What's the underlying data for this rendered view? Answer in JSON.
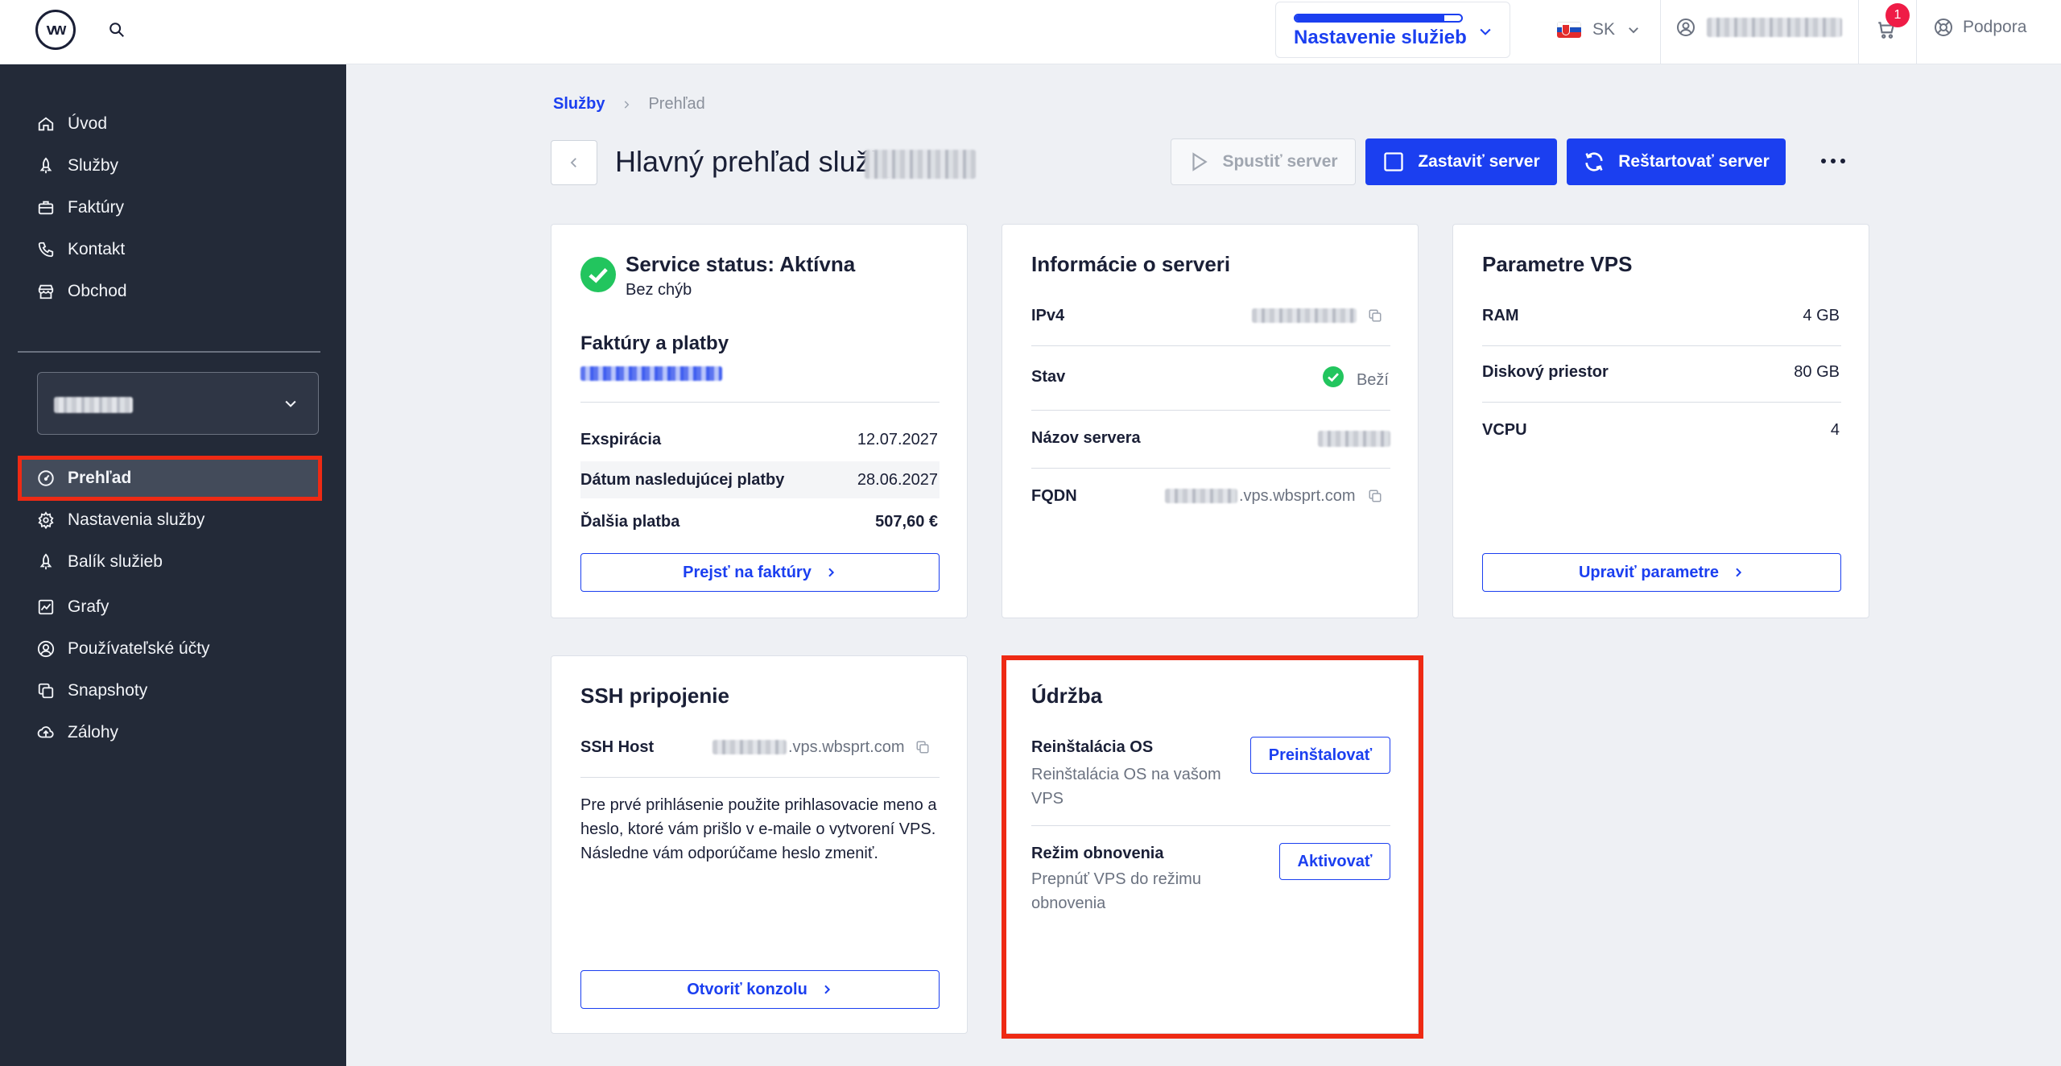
{
  "topbar": {
    "logo_text": "vw",
    "setup": {
      "label": "Nastavenie služieb",
      "progress_percent": 90
    },
    "language": "SK",
    "cart_count": "1",
    "support_label": "Podpora"
  },
  "sidebar": {
    "top_items": [
      {
        "label": "Úvod",
        "icon": "home-icon"
      },
      {
        "label": "Služby",
        "icon": "rocket-icon"
      },
      {
        "label": "Faktúry",
        "icon": "briefcase-icon"
      },
      {
        "label": "Kontakt",
        "icon": "phone-icon"
      },
      {
        "label": "Obchod",
        "icon": "store-icon"
      }
    ],
    "service_items": [
      {
        "label": "Prehľad",
        "icon": "gauge-icon",
        "active": true
      },
      {
        "label": "Nastavenia služby",
        "icon": "gear-icon"
      },
      {
        "label": "Balík služieb",
        "icon": "rocket-icon"
      },
      {
        "label": "Grafy",
        "icon": "chart-icon"
      },
      {
        "label": "Používateľské účty",
        "icon": "user-circle-icon"
      },
      {
        "label": "Snapshoty",
        "icon": "copy-icon"
      },
      {
        "label": "Zálohy",
        "icon": "cloud-upload-icon"
      }
    ]
  },
  "breadcrumb": {
    "root": "Služby",
    "current": "Prehľad"
  },
  "page": {
    "title": "Hlavný prehľad služby",
    "start_label": "Spustiť server",
    "stop_label": "Zastaviť server",
    "restart_label": "Reštartovať server"
  },
  "status_card": {
    "title": "Service status: Aktívna",
    "subtitle": "Bez chýb",
    "invoices_title": "Faktúry a platby",
    "rows": [
      {
        "label": "Exspirácia",
        "value": "12.07.2027"
      },
      {
        "label": "Dátum nasledujúcej platby",
        "value": "28.06.2027"
      },
      {
        "label": "Ďalšia platba",
        "value": "507,60 €"
      }
    ],
    "button": "Prejsť na faktúry"
  },
  "server_card": {
    "title": "Informácie o serveri",
    "ipv4_label": "IPv4",
    "state_label": "Stav",
    "state_value": "Beží",
    "name_label": "Názov servera",
    "fqdn_label": "FQDN",
    "fqdn_suffix": ".vps.wbsprt.com"
  },
  "vps_card": {
    "title": "Parametre VPS",
    "rows": [
      {
        "label": "RAM",
        "value": "4 GB"
      },
      {
        "label": "Diskový priestor",
        "value": "80 GB"
      },
      {
        "label": "VCPU",
        "value": "4"
      }
    ],
    "button": "Upraviť parametre"
  },
  "ssh_card": {
    "title": "SSH pripojenie",
    "host_label": "SSH Host",
    "host_suffix": ".vps.wbsprt.com",
    "note": "Pre prvé prihlásenie použite prihlasovacie meno a heslo, ktoré vám prišlo v e-maile o vytvorení VPS. Následne vám odporúčame heslo zmeniť.",
    "button": "Otvoriť konzolu"
  },
  "maintenance_card": {
    "title": "Údržba",
    "reinstall_title": "Reinštalácia OS",
    "reinstall_desc": "Reinštalácia OS na vašom VPS",
    "reinstall_button": "Preinštalovať",
    "recovery_title": "Režim obnovenia",
    "recovery_desc": "Prepnúť VPS do režimu obnovenia",
    "recovery_button": "Aktivovať"
  },
  "colors": {
    "accent": "#1b3ff0",
    "sidebar_bg": "#232a38",
    "highlight": "#ee2a14",
    "success": "#22c55e"
  }
}
